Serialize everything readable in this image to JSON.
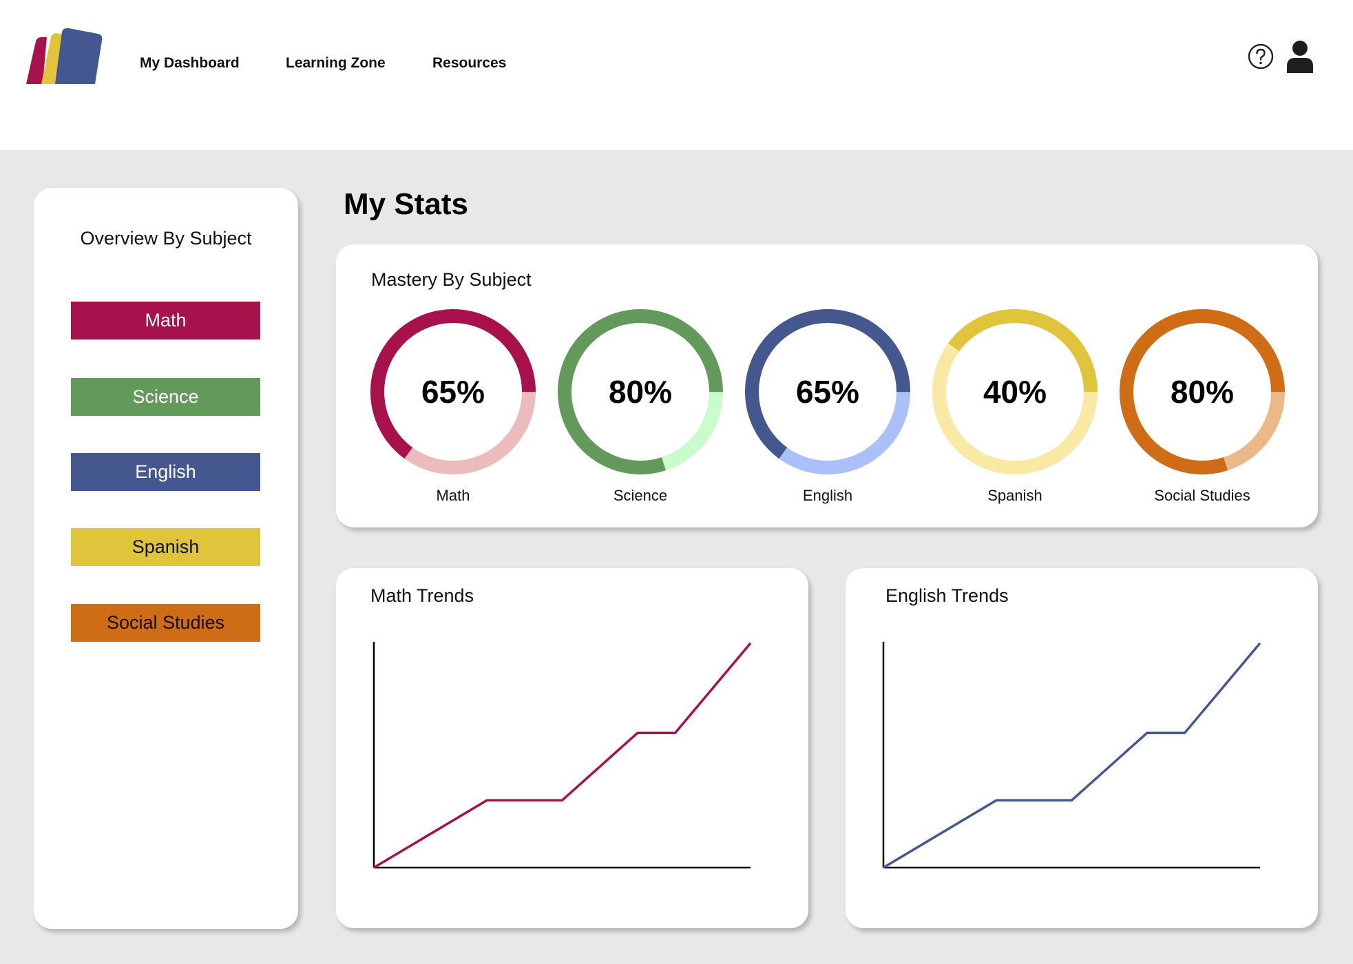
{
  "app": {
    "logo_colors": [
      "#a8124c",
      "#e0c43b",
      "#44588f"
    ]
  },
  "nav": {
    "items": [
      {
        "label": "My Dashboard",
        "active": true
      },
      {
        "label": "Learning Zone",
        "active": false
      },
      {
        "label": "Resources",
        "active": false
      }
    ],
    "icons": [
      "help-circle-icon",
      "user-profile-icon"
    ]
  },
  "sidebar": {
    "title": "Overview By Subject",
    "subjects": [
      {
        "label": "Math",
        "color": "#a8124c",
        "text_color": "#ffffff"
      },
      {
        "label": "Science",
        "color": "#63995a",
        "text_color": "#ffffff"
      },
      {
        "label": "English",
        "color": "#44588f",
        "text_color": "#ffffff"
      },
      {
        "label": "Spanish",
        "color": "#e0c43b",
        "text_color": "#111111"
      },
      {
        "label": "Social Studies",
        "color": "#cf6d17",
        "text_color": "#111111"
      }
    ]
  },
  "page_title": "My Stats",
  "mastery": {
    "title": "Mastery By Subject",
    "gauges": [
      {
        "subject": "Math",
        "percent_label": "65%",
        "value": 0.65,
        "color": "#a8124c",
        "track": "#ecbcbc"
      },
      {
        "subject": "Science",
        "percent_label": "80%",
        "value": 0.8,
        "color": "#63995a",
        "track": "#c9fccc"
      },
      {
        "subject": "English",
        "percent_label": "65%",
        "value": 0.65,
        "color": "#44588f",
        "track": "#a9c1f8"
      },
      {
        "subject": "Spanish",
        "percent_label": "40%",
        "value": 0.4,
        "color": "#e0c43b",
        "track": "#f8e9a4"
      },
      {
        "subject": "Social Studies",
        "percent_label": "80%",
        "value": 0.8,
        "color": "#cf6d17",
        "track": "#ecb888"
      }
    ]
  },
  "chart_data": [
    {
      "type": "line",
      "title": "Math Trends",
      "color": "#a8124c",
      "x": [
        0,
        3,
        5,
        7,
        8,
        10
      ],
      "y": [
        0,
        3,
        3,
        6,
        6,
        10
      ],
      "xlim": [
        0,
        10
      ],
      "ylim": [
        0,
        10
      ],
      "grid": false
    },
    {
      "type": "line",
      "title": "English Trends",
      "color": "#44588f",
      "x": [
        0,
        3,
        5,
        7,
        8,
        10
      ],
      "y": [
        0,
        3,
        3,
        6,
        6,
        10
      ],
      "xlim": [
        0,
        10
      ],
      "ylim": [
        0,
        10
      ],
      "grid": false
    }
  ]
}
